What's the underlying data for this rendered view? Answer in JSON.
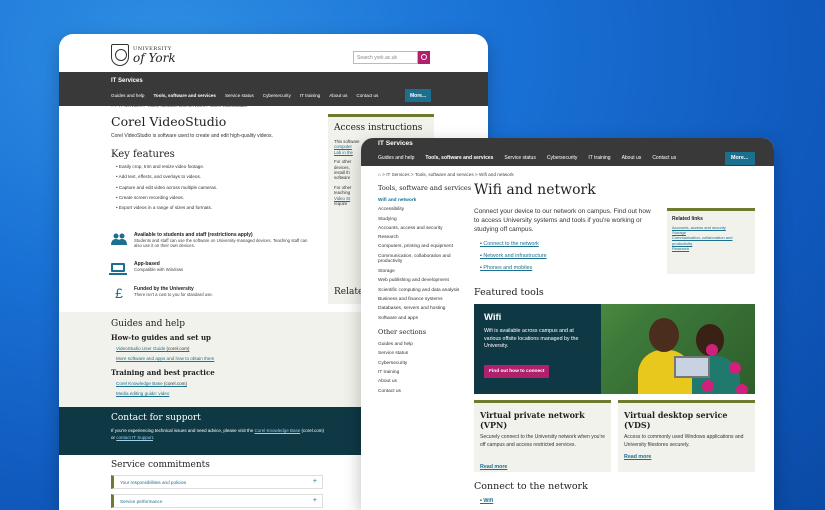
{
  "window1": {
    "logo": {
      "line1": "UNIVERSITY",
      "line2": "of York"
    },
    "search_placeholder": "Search york.ac.uk",
    "site_title": "IT Services",
    "nav": [
      "Guides and help",
      "Tools, software and services",
      "Service status",
      "Cybersecurity",
      "IT training",
      "About us",
      "Contact us"
    ],
    "more": "More...",
    "breadcrumb": [
      "IT Services",
      "Tools, software and services",
      "Corel VideoStudio"
    ],
    "page_title": "Corel VideoStudio",
    "intro": "Corel VideoStudio is software used to create and edit high-quality videos.",
    "key_features_heading": "Key features",
    "key_features": [
      "Easily crop, trim and resize video footage.",
      "Add text, effects, and overlays to videos.",
      "Capture and edit video across multiple cameras.",
      "Create screen recording videos.",
      "Export videos in a range of sizes and formats."
    ],
    "access_heading": "Access instructions",
    "access_frag": [
      "This software",
      "computer",
      "Lab in the",
      "For other",
      "devices,",
      "install th",
      "software",
      "For other",
      "teaching",
      "Video St",
      "require"
    ],
    "related_heading": "Relate",
    "related_frag": [
      "Adobe",
      "Creati",
      "More",
      "and ac"
    ],
    "features": [
      {
        "title": "Available to students and staff (restrictions apply)",
        "desc": "Students and staff can use the software on University-managed devices. Teaching staff can also use it on their own devices."
      },
      {
        "title": "App-based",
        "desc": "Compatible with Windows"
      },
      {
        "title": "Funded by the University",
        "desc": "There isn't a cost to you for standard use."
      }
    ],
    "guides": {
      "heading": "Guides and help",
      "sub1": "How-to guides and set up",
      "sub1_links": [
        {
          "link": "VideoStudio User Guide",
          "suffix": " (corel.com)"
        },
        {
          "link": "More software and apps and how to obtain them",
          "suffix": ""
        }
      ],
      "sub2": "Training and best practice",
      "sub2_links": [
        {
          "link": "Corel Knowledge Base",
          "suffix": " (corel.com)"
        },
        {
          "link": "Media editing guide: video",
          "suffix": ""
        }
      ]
    },
    "contact": {
      "heading": "Contact for support",
      "text_before": "If you're experiencing technical issues and need advice, please visit the ",
      "link1": "Corel Knowledge Base",
      "text_mid": " (corel.com) or ",
      "link2": "contact IT Support",
      "text_after": "."
    },
    "service_heading": "Service commitments",
    "accordions": [
      "Your responsibilities and policies",
      "Service performance"
    ]
  },
  "window2": {
    "site_title": "IT Services",
    "nav": [
      "Guides and help",
      "Tools, software and services",
      "Service status",
      "Cybersecurity",
      "IT training",
      "About us",
      "Contact us"
    ],
    "more": "More...",
    "breadcrumb": [
      "IT Services",
      "Tools, software and services",
      "Wifi and network"
    ],
    "sidebar_heading": "Tools, software and services",
    "sidebar_items": [
      "Wifi and network",
      "Accessibility",
      "Studying",
      "Accounts, access and security",
      "Research",
      "Computers, printing and equipment",
      "Communication, collaboration and productivity",
      "Storage",
      "Web publishing and development",
      "Scientific computing and data analysis",
      "Business and finance systems",
      "Databases, servers and hosting",
      "Software and apps"
    ],
    "other_heading": "Other sections",
    "other_items": [
      "Guides and help",
      "Service status",
      "Cybersecurity",
      "IT training",
      "About us",
      "Contact us"
    ],
    "page_title": "Wifi and network",
    "intro": "Connect your device to our network on campus. Find out how to access University systems and tools if you're working or studying off campus.",
    "links": [
      "Connect to the network",
      "Network and infrastructure",
      "Phones and mobiles"
    ],
    "related": {
      "heading": "Related links",
      "links": [
        "Accounts, access and security",
        "Storage",
        "Communication, collaboration and productivity",
        "Research"
      ]
    },
    "featured_heading": "Featured tools",
    "hero": {
      "title": "Wifi",
      "desc": "Wifi is available across campus and at various offsite locations managed by the University.",
      "button": "Find out how to connect"
    },
    "cards": [
      {
        "title": "Virtual private network (VPN)",
        "desc": "Securely connect to the University network when you're off campus and access restricted services.",
        "link": "Read more"
      },
      {
        "title": "Virtual desktop service (VDS)",
        "desc": "Access to commonly used Windows applications and University filestores securely.",
        "link": "Read more"
      }
    ],
    "connect_heading": "Connect to the network",
    "connect_link": "Wifi"
  }
}
